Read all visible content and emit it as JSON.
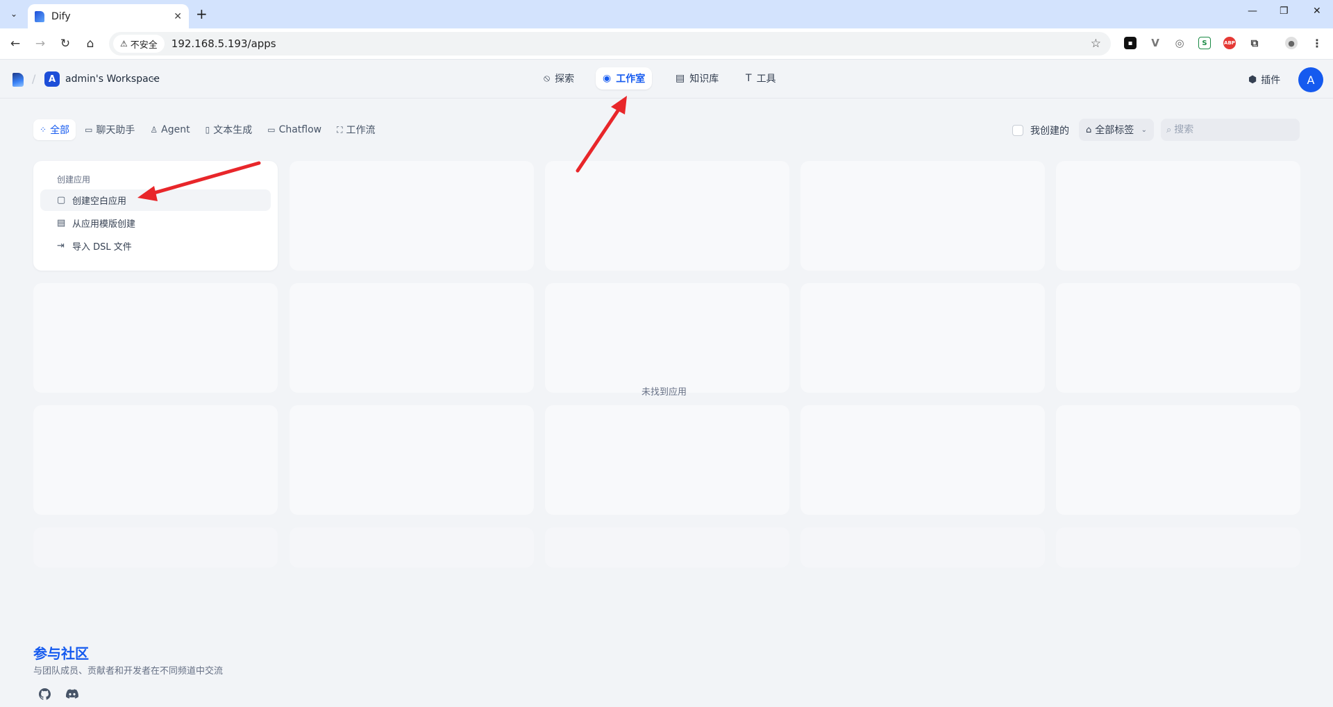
{
  "browser": {
    "tab_title": "Dify",
    "security_label": "不安全",
    "url": "192.168.5.193/apps"
  },
  "header": {
    "workspace_initial": "A",
    "workspace_name": "admin's Workspace",
    "nav": [
      {
        "label": "探索",
        "icon": "compass-icon"
      },
      {
        "label": "工作室",
        "icon": "robot-icon",
        "active": true
      },
      {
        "label": "知识库",
        "icon": "book-icon"
      },
      {
        "label": "工具",
        "icon": "hammer-icon"
      }
    ],
    "plugin_label": "插件",
    "user_initial": "A"
  },
  "filters": {
    "tabs": [
      {
        "label": "全部",
        "active": true
      },
      {
        "label": "聊天助手"
      },
      {
        "label": "Agent"
      },
      {
        "label": "文本生成"
      },
      {
        "label": "Chatflow"
      },
      {
        "label": "工作流"
      }
    ],
    "mine_label": "我创建的",
    "tags_label": "全部标签",
    "search_placeholder": "搜索"
  },
  "create_card": {
    "label": "创建应用",
    "options": [
      "创建空白应用",
      "从应用模版创建",
      "导入 DSL 文件"
    ]
  },
  "empty_text": "未找到应用",
  "community": {
    "title": "参与社区",
    "desc": "与团队成员、贡献者和开发者在不同频道中交流"
  },
  "colors": {
    "accent": "#155aef",
    "annotation_arrow": "#e8262a"
  }
}
